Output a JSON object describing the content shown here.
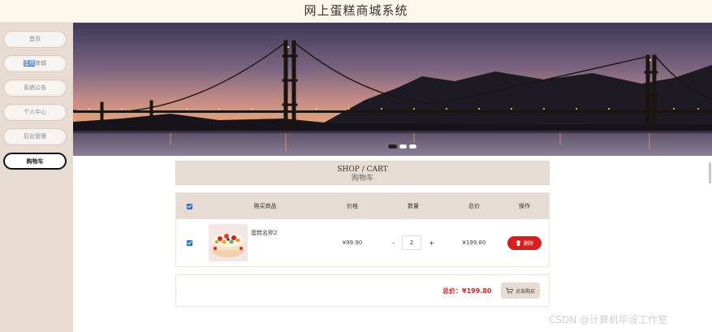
{
  "header": {
    "title": "网上蛋糕商城系统"
  },
  "sidebar": {
    "items": [
      {
        "label": "首页"
      },
      {
        "label_selected": "蛋糕",
        "label_rest": "商城"
      },
      {
        "label": "系统公告"
      },
      {
        "label": "个人中心"
      },
      {
        "label": "后台管理"
      },
      {
        "label": "购物车"
      }
    ],
    "active_index": 5
  },
  "banner": {
    "slide_count": 3,
    "active_slide": 1
  },
  "cart": {
    "title_en": "SHOP / CART",
    "title_cn": "购物车",
    "columns": [
      "购买商品",
      "价格",
      "数量",
      "总价",
      "操作"
    ],
    "rows": [
      {
        "name": "蛋糕名称2",
        "price": "¥99.90",
        "qty": "2",
        "minus": "-",
        "plus": "+",
        "subtotal": "¥199.80",
        "delete_label": "删除"
      }
    ],
    "total_label": "总价：¥199.80",
    "buy_label": "点击购买"
  },
  "watermark": "CSDN @计算机毕设工作室",
  "colors": {
    "accent": "#d81e1e",
    "header_bg": "#fdf7ec",
    "sidebar_bg": "#e8dcd2",
    "table_head_bg": "#e7dcd3",
    "checkbox": "#2b6fd8"
  }
}
